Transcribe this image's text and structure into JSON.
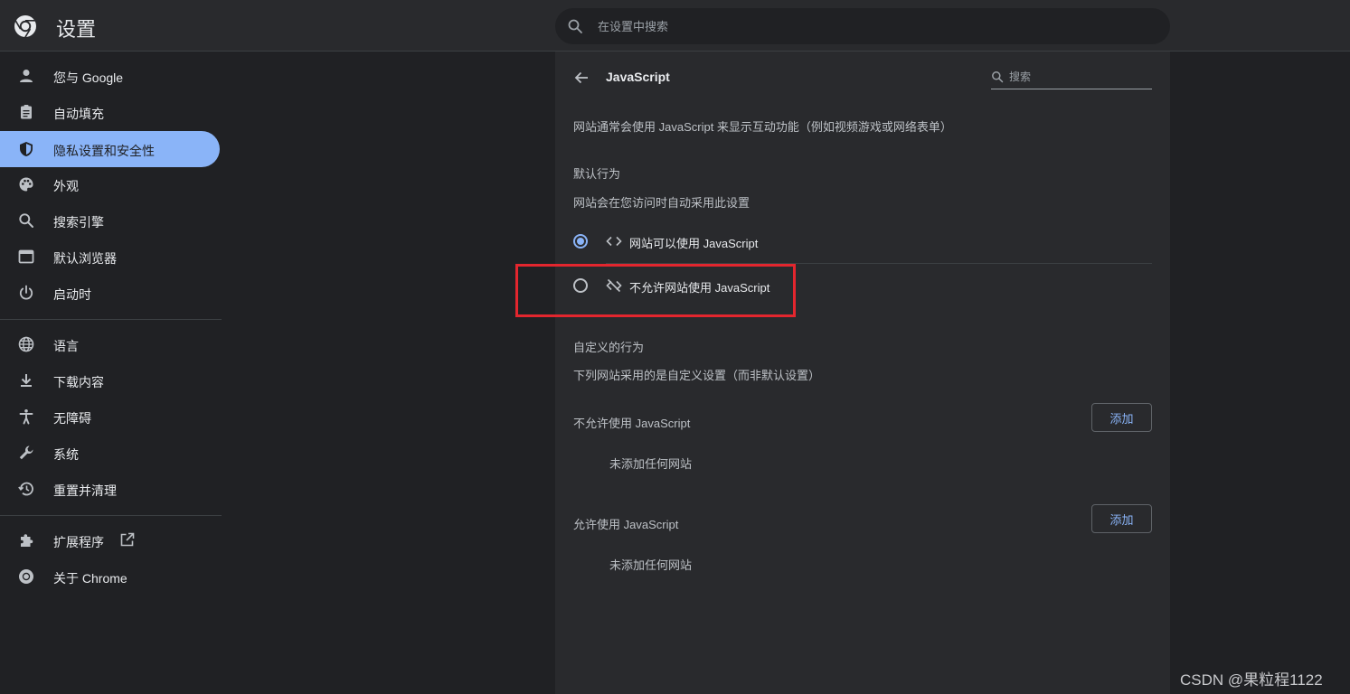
{
  "header": {
    "title": "设置",
    "search_placeholder": "在设置中搜索"
  },
  "sidebar": {
    "items": [
      {
        "label": "您与 Google",
        "icon": "person-icon"
      },
      {
        "label": "自动填充",
        "icon": "clipboard-icon"
      },
      {
        "label": "隐私设置和安全性",
        "icon": "shield-icon",
        "active": true
      },
      {
        "label": "外观",
        "icon": "palette-icon"
      },
      {
        "label": "搜索引擎",
        "icon": "search-icon"
      },
      {
        "label": "默认浏览器",
        "icon": "browser-icon"
      },
      {
        "label": "启动时",
        "icon": "power-icon"
      },
      {
        "label": "语言",
        "icon": "globe-icon"
      },
      {
        "label": "下载内容",
        "icon": "download-icon"
      },
      {
        "label": "无障碍",
        "icon": "accessibility-icon"
      },
      {
        "label": "系统",
        "icon": "wrench-icon"
      },
      {
        "label": "重置并清理",
        "icon": "restore-icon"
      },
      {
        "label": "扩展程序",
        "icon": "puzzle-icon"
      },
      {
        "label": "关于 Chrome",
        "icon": "chrome-icon"
      }
    ]
  },
  "main": {
    "title": "JavaScript",
    "search_placeholder": "搜索",
    "description": "网站通常会使用 JavaScript 来显示互动功能（例如视频游戏或网络表单）",
    "default_behavior": {
      "heading": "默认行为",
      "subtext": "网站会在您访问时自动采用此设置",
      "options": [
        {
          "label": "网站可以使用 JavaScript",
          "icon": "code-icon",
          "selected": true
        },
        {
          "label": "不允许网站使用 JavaScript",
          "icon": "code-off-icon",
          "selected": false
        }
      ]
    },
    "custom_behavior": {
      "heading": "自定义的行为",
      "subtext": "下列网站采用的是自定义设置（而非默认设置）",
      "blocked": {
        "label": "不允许使用 JavaScript",
        "add_label": "添加",
        "empty_text": "未添加任何网站"
      },
      "allowed": {
        "label": "允许使用 JavaScript",
        "add_label": "添加",
        "empty_text": "未添加任何网站"
      }
    }
  },
  "watermark": "CSDN @果粒程1122",
  "colors": {
    "accent": "#8ab4f8",
    "highlight": "#e3262e",
    "background": "#202124",
    "card": "#292a2d"
  }
}
